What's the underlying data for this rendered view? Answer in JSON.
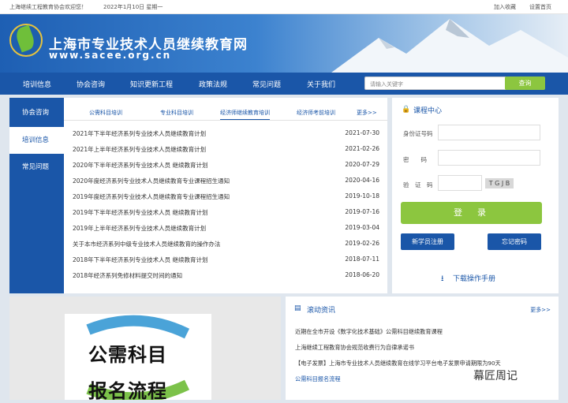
{
  "topbar": {
    "welcome": "上海继续工程教育协会欢迎您！",
    "date": "2022年1月10日 星期一",
    "favorite": "加入收藏",
    "home": "设置首页"
  },
  "header": {
    "title": "上海市专业技术人员继续教育网",
    "url": "www.sacee.org.cn"
  },
  "nav": {
    "items": [
      "培训信息",
      "协会咨询",
      "知识更新工程",
      "政策法规",
      "常见问题",
      "关于我们"
    ],
    "search_placeholder": "请输入关键字",
    "search_button": "查询"
  },
  "sidebar": {
    "items": [
      "协会咨询",
      "培训信息",
      "常见问题"
    ]
  },
  "tabs": [
    "公需科目培训",
    "专业科目培训",
    "经济师继续教育培训",
    "经济师考前培训",
    "更多>>"
  ],
  "list": [
    {
      "title": "2021年下半年经济系列专业技术人员继续教育计划",
      "date": "2021-07-30"
    },
    {
      "title": "2021年上半年经济系列专业技术人员继续教育计划",
      "date": "2021-02-26"
    },
    {
      "title": "2020年下半年经济系列专业技术人员 继续教育计划",
      "date": "2020-07-29"
    },
    {
      "title": "2020年度经济系列专业技术人员继续教育专业课程招生通知",
      "date": "2020-04-16"
    },
    {
      "title": "2019年度经济系列专业技术人员继续教育专业课程招生通知",
      "date": "2019-10-18"
    },
    {
      "title": "2019年下半年经济系列专业技术人员 继续教育计划",
      "date": "2019-07-16"
    },
    {
      "title": "2019年上半年经济系列专业技术人员继续教育计划",
      "date": "2019-03-04"
    },
    {
      "title": "关于本市经济系列中级专业技术人员继续教育的操作办法",
      "date": "2019-02-26"
    },
    {
      "title": "2018年下半年经济系列专业技术人员 继续教育计划",
      "date": "2018-07-11"
    },
    {
      "title": "2018年经济系列免修材料提交时间的通知",
      "date": "2018-06-20"
    }
  ],
  "login": {
    "title": "课程中心",
    "id_label": "身份证号码",
    "pwd_label": "密　　码",
    "captcha_label": "验　证　码",
    "captcha_value": "T G J B",
    "login_button": "登　录",
    "register": "新学员注册",
    "forgot": "忘记密码",
    "download": "下载操作手册"
  },
  "poster": {
    "line1": "公需科目",
    "line2": "报名流程"
  },
  "news": {
    "title": "滚动资讯",
    "more": "更多>>",
    "items": [
      "近期在全市开设《数字化技术基础》公需科目继续教育课程",
      "上海继续工程教育协会规范收费行为自律承诺书",
      "【电子发票】上海市专业技术人员继续教育在线学习平台电子发票申请期限为90天",
      "公需科目报名流程"
    ]
  },
  "watermark": "幕匠周记"
}
